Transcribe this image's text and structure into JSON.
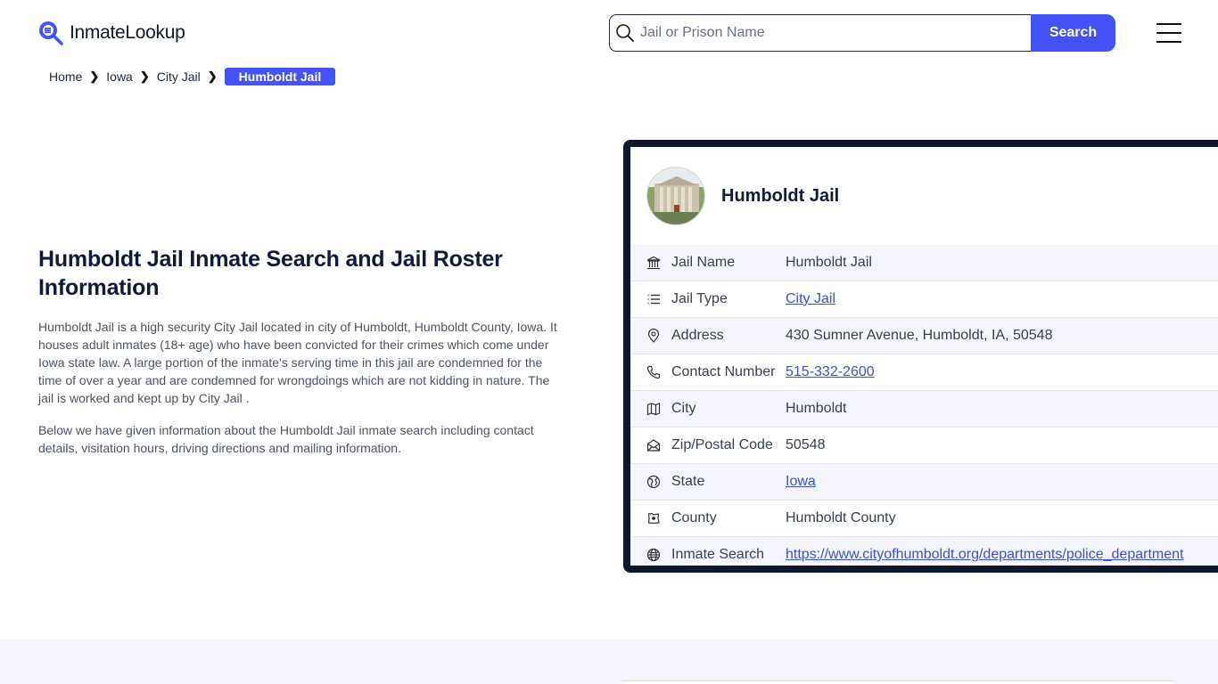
{
  "header": {
    "logo_text": "InmateLookup",
    "search_placeholder": "Jail or Prison Name",
    "search_value": "",
    "search_button": "Search"
  },
  "breadcrumb": [
    {
      "label": "Home"
    },
    {
      "label": "Iowa"
    },
    {
      "label": "City Jail"
    },
    {
      "label": "Humboldt Jail",
      "active": true
    }
  ],
  "intro": {
    "title": "Humboldt Jail Inmate Search and Jail Roster Information",
    "paragraphs": [
      "Humboldt Jail is a high security City Jail located in city of Humboldt, Humboldt County, Iowa. It houses adult inmates (18+ age) who have been convicted for their crimes which come under Iowa state law. A large portion of the inmate's serving time in this jail are condemned for the time of over a year and are condemned for wrongdoings which are not kidding in nature. The jail is worked and kept up by City Jail .",
      "Below we have given information about the Humboldt Jail inmate search including contact details, visitation hours, driving directions and mailing information."
    ]
  },
  "card": {
    "title": "Humboldt Jail",
    "rows": [
      {
        "icon": "bank-icon",
        "label": "Jail Name",
        "value": "Humboldt Jail",
        "link": false
      },
      {
        "icon": "list-icon",
        "label": "Jail Type",
        "value": "City Jail",
        "link": true
      },
      {
        "icon": "map-pin-icon",
        "label": "Address",
        "value": "430 Sumner Avenue, Humboldt, IA, 50548",
        "link": false
      },
      {
        "icon": "phone-icon",
        "label": "Contact Number",
        "value": "515-332-2600",
        "link": true
      },
      {
        "icon": "map-icon",
        "label": "City",
        "value": "Humboldt",
        "link": false
      },
      {
        "icon": "mail-open-icon",
        "label": "Zip/Postal Code",
        "value": "50548",
        "link": false
      },
      {
        "icon": "globe-region-icon",
        "label": "State",
        "value": "Iowa",
        "link": true
      },
      {
        "icon": "county-map-icon",
        "label": "County",
        "value": "Humboldt County",
        "link": false
      },
      {
        "icon": "globe-icon",
        "label": "Inmate Search",
        "value": "https://www.cityofhumboldt.org/departments/police_department",
        "link": true
      }
    ]
  },
  "colors": {
    "accent": "#4353f5",
    "card_border": "#0f172a",
    "link": "#3b4fd8",
    "row_alt": "#f5f6fd"
  }
}
